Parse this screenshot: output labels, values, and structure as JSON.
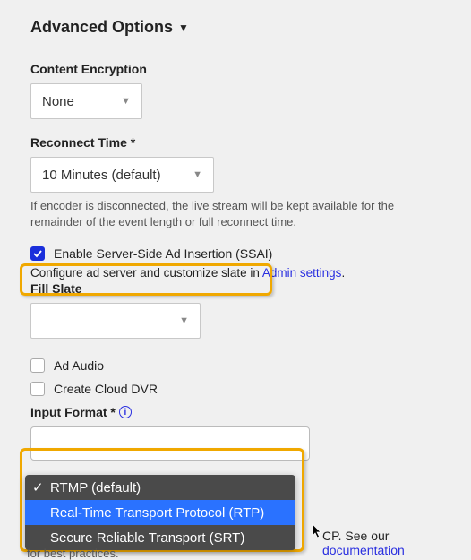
{
  "section_title": "Advanced Options",
  "content_encryption": {
    "label": "Content Encryption",
    "value": "None"
  },
  "reconnect_time": {
    "label": "Reconnect Time *",
    "value": "10 Minutes (default)",
    "note": "If encoder is disconnected, the live stream will be kept available for the remainder of the event length or full reconnect time."
  },
  "ssai": {
    "label": "Enable Server-Side Ad Insertion (SSAI)",
    "checked": true,
    "config_prefix": "Configure ad server and customize slate in ",
    "config_link": "Admin settings",
    "config_suffix": "."
  },
  "fill_slate": {
    "label": "Fill Slate",
    "value": ""
  },
  "ad_audio": {
    "label": "Ad Audio",
    "checked": false
  },
  "cloud_dvr": {
    "label": "Create Cloud DVR",
    "checked": false
  },
  "input_format": {
    "label": "Input Format *",
    "options": [
      "RTMP (default)",
      "Real-Time Transport Protocol (RTP)",
      "Secure Reliable Transport (SRT)"
    ],
    "selected_index": 0,
    "hover_index": 1
  },
  "bottom_partial": {
    "frag1": "CP. See our ",
    "link": "documentation",
    "frag_cut": "for best practices."
  }
}
